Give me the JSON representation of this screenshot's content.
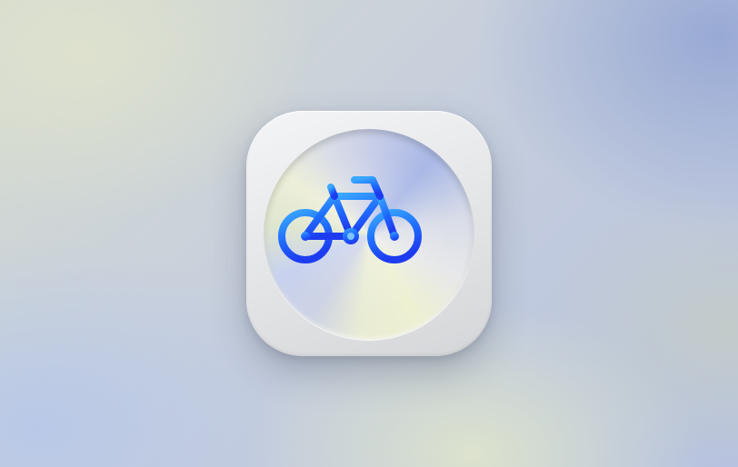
{
  "app_icon": {
    "icon": "bicycle-icon",
    "symbol_colors": {
      "light": "#3aa8ff",
      "mid": "#1f6cff",
      "dark": "#1d3cf0"
    },
    "tile_color": "#e6e7e9"
  }
}
